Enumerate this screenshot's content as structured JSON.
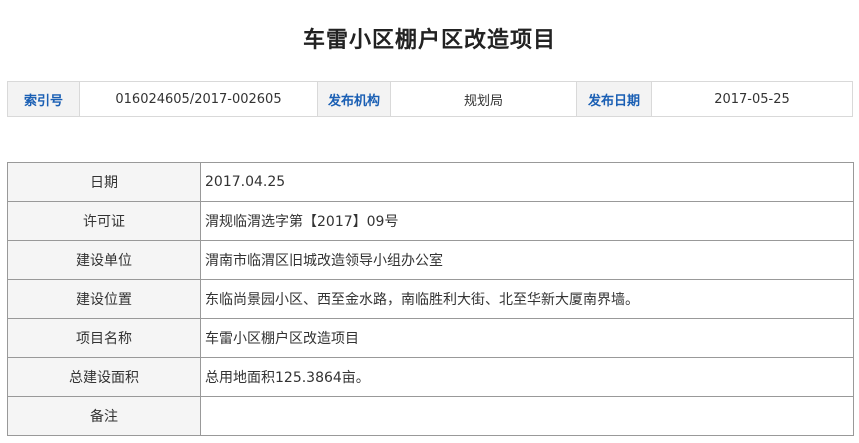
{
  "page": {
    "title": "车雷小区棚户区改造项目"
  },
  "meta": {
    "index_label": "索引号",
    "index_value": "016024605/2017-002605",
    "org_label": "发布机构",
    "org_value": "规划局",
    "date_label": "发布日期",
    "date_value": "2017-05-25"
  },
  "details": [
    {
      "label": "日期",
      "value": "2017.04.25"
    },
    {
      "label": "许可证",
      "value": "渭规临渭选字第【2017】09号"
    },
    {
      "label": "建设单位",
      "value": "渭南市临渭区旧城改造领导小组办公室"
    },
    {
      "label": "建设位置",
      "value": "东临尚景园小区、西至金水路，南临胜利大街、北至华新大厦南界墙。"
    },
    {
      "label": "项目名称",
      "value": "车雷小区棚户区改造项目"
    },
    {
      "label": "总建设面积",
      "value": "总用地面积125.3864亩。"
    },
    {
      "label": "备注",
      "value": ""
    }
  ]
}
